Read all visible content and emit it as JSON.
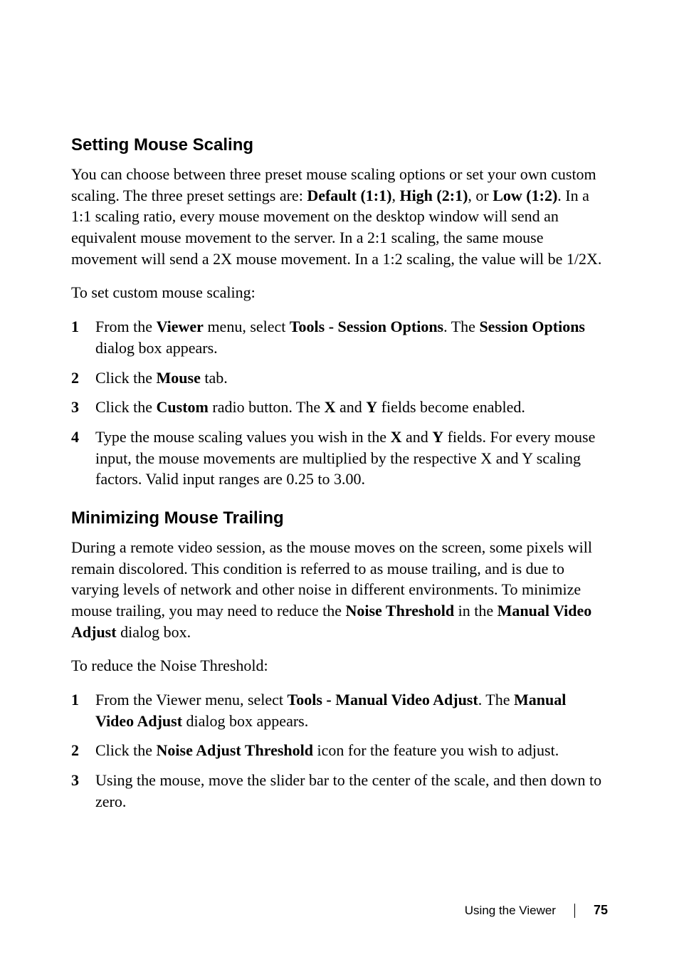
{
  "section1": {
    "heading": "Setting Mouse Scaling",
    "intro_parts": {
      "t1": "You can choose between three preset mouse scaling options or set your own custom scaling. The three preset settings are: ",
      "b1": "Default (1:1)",
      "t2": ", ",
      "b2": "High (2:1)",
      "t3": ", or ",
      "b3": "Low (1:2)",
      "t4": ". In a 1:1 scaling ratio, every mouse movement on the desktop window will send an equivalent mouse movement to the server. In a 2:1 scaling, the same mouse movement will send a 2X mouse movement. In a 1:2 scaling, the value will be 1/2X."
    },
    "lead": "To set custom mouse scaling:",
    "items": [
      {
        "num": "1",
        "parts": {
          "t1": "From the ",
          "b1": "Viewer",
          "t2": " menu, select ",
          "b2": "Tools - Session Options",
          "t3": ". The ",
          "b3": "Session Options",
          "t4": " dialog box appears."
        }
      },
      {
        "num": "2",
        "parts": {
          "t1": "Click the ",
          "b1": "Mouse",
          "t2": " tab."
        }
      },
      {
        "num": "3",
        "parts": {
          "t1": "Click the ",
          "b1": "Custom",
          "t2": " radio button. The ",
          "b2": "X",
          "t3": " and ",
          "b3": "Y",
          "t4": " fields become enabled."
        }
      },
      {
        "num": "4",
        "parts": {
          "t1": "Type the mouse scaling values you wish in the ",
          "b1": "X",
          "t2": " and ",
          "b2": "Y",
          "t3": " fields. For every mouse input, the mouse movements are multiplied by the respective X and Y scaling factors. Valid input ranges are 0.25 to 3.00."
        }
      }
    ]
  },
  "section2": {
    "heading": "Minimizing Mouse Trailing",
    "intro_parts": {
      "t1": "During a remote video session, as the mouse moves on the screen, some pixels will remain discolored. This condition is referred to as mouse trailing, and is due to varying levels of network and other noise in different environments. To minimize mouse trailing, you may need to reduce the ",
      "b1": "Noise Threshold",
      "t2": " in the ",
      "b2": "Manual Video Adjust",
      "t3": " dialog box."
    },
    "lead": "To reduce the Noise Threshold:",
    "items": [
      {
        "num": "1",
        "parts": {
          "t1": "From the Viewer menu, select ",
          "b1": "Tools - Manual Video Adjust",
          "t2": ". The ",
          "b2": "Manual Video Adjust",
          "t3": " dialog box appears."
        }
      },
      {
        "num": "2",
        "parts": {
          "t1": "Click the ",
          "b1": "Noise Adjust Threshold",
          "t2": " icon for the feature you wish to adjust."
        }
      },
      {
        "num": "3",
        "parts": {
          "t1": "Using the mouse, move the slider bar to the center of the scale, and then down to zero."
        }
      }
    ]
  },
  "footer": {
    "chapter": "Using the Viewer",
    "page": "75"
  }
}
